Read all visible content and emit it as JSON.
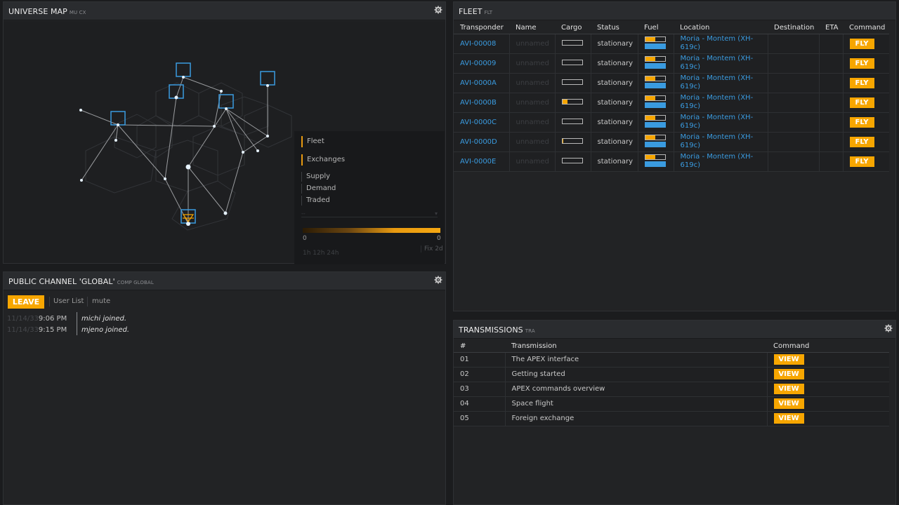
{
  "map": {
    "title": "UNIVERSE MAP",
    "subtitle": "MU CX",
    "legend": {
      "items": [
        "Fleet",
        "Exchanges",
        "Supply",
        "Demand",
        "Traded"
      ],
      "select_placeholder": "--",
      "min": "0",
      "max": "0",
      "time_range": "1h 12h 24h",
      "fix": "Fix 2d"
    }
  },
  "chat": {
    "title": "PUBLIC CHANNEL 'GLOBAL'",
    "subtitle": "COMP GLOBAL",
    "leave_label": "LEAVE",
    "user_list_label": "User List",
    "mute_label": "mute",
    "messages": [
      {
        "date": "11/14/33",
        "time": "9:06 PM",
        "text": "michi joined."
      },
      {
        "date": "11/14/33",
        "time": "9:15 PM",
        "text": "mjeno joined."
      }
    ]
  },
  "fleet": {
    "title": "FLEET",
    "subtitle": "FLT",
    "columns": [
      "Transponder",
      "Name",
      "Cargo",
      "Status",
      "Fuel",
      "Location",
      "Destination",
      "ETA",
      "Command"
    ],
    "rows": [
      {
        "transponder": "AVI-00008",
        "name": "unnamed",
        "cargo": 0,
        "status": "stationary",
        "fuel_level": 0.5,
        "location": "Moria - Montem (XH-619c)",
        "destination": "",
        "eta": "",
        "command": "FLY"
      },
      {
        "transponder": "AVI-00009",
        "name": "unnamed",
        "cargo": 0,
        "status": "stationary",
        "fuel_level": 0.5,
        "location": "Moria - Montem (XH-619c)",
        "destination": "",
        "eta": "",
        "command": "FLY"
      },
      {
        "transponder": "AVI-0000A",
        "name": "unnamed",
        "cargo": 0,
        "status": "stationary",
        "fuel_level": 0.5,
        "location": "Moria - Montem (XH-619c)",
        "destination": "",
        "eta": "",
        "command": "FLY"
      },
      {
        "transponder": "AVI-0000B",
        "name": "unnamed",
        "cargo": 0.25,
        "status": "stationary",
        "fuel_level": 0.5,
        "location": "Moria - Montem (XH-619c)",
        "destination": "",
        "eta": "",
        "command": "FLY"
      },
      {
        "transponder": "AVI-0000C",
        "name": "unnamed",
        "cargo": 0,
        "status": "stationary",
        "fuel_level": 0.5,
        "location": "Moria - Montem (XH-619c)",
        "destination": "",
        "eta": "",
        "command": "FLY"
      },
      {
        "transponder": "AVI-0000D",
        "name": "unnamed",
        "cargo": 0.05,
        "status": "stationary",
        "fuel_level": 0.5,
        "location": "Moria - Montem (XH-619c)",
        "destination": "",
        "eta": "",
        "command": "FLY"
      },
      {
        "transponder": "AVI-0000E",
        "name": "unnamed",
        "cargo": 0,
        "status": "stationary",
        "fuel_level": 0.5,
        "location": "Moria - Montem (XH-619c)",
        "destination": "",
        "eta": "",
        "command": "FLY"
      }
    ]
  },
  "transmissions": {
    "title": "TRANSMISSIONS",
    "subtitle": "TRA",
    "columns": [
      "#",
      "Transmission",
      "Command"
    ],
    "rows": [
      {
        "num": "01",
        "title": "The APEX interface",
        "command": "VIEW"
      },
      {
        "num": "02",
        "title": "Getting started",
        "command": "VIEW"
      },
      {
        "num": "03",
        "title": "APEX commands overview",
        "command": "VIEW"
      },
      {
        "num": "04",
        "title": "Space flight",
        "command": "VIEW"
      },
      {
        "num": "05",
        "title": "Foreign exchange",
        "command": "VIEW"
      }
    ]
  },
  "colors": {
    "accent": "#f7a600",
    "link": "#3a9be0",
    "panel": "#222325",
    "background": "#1b1c1e"
  }
}
